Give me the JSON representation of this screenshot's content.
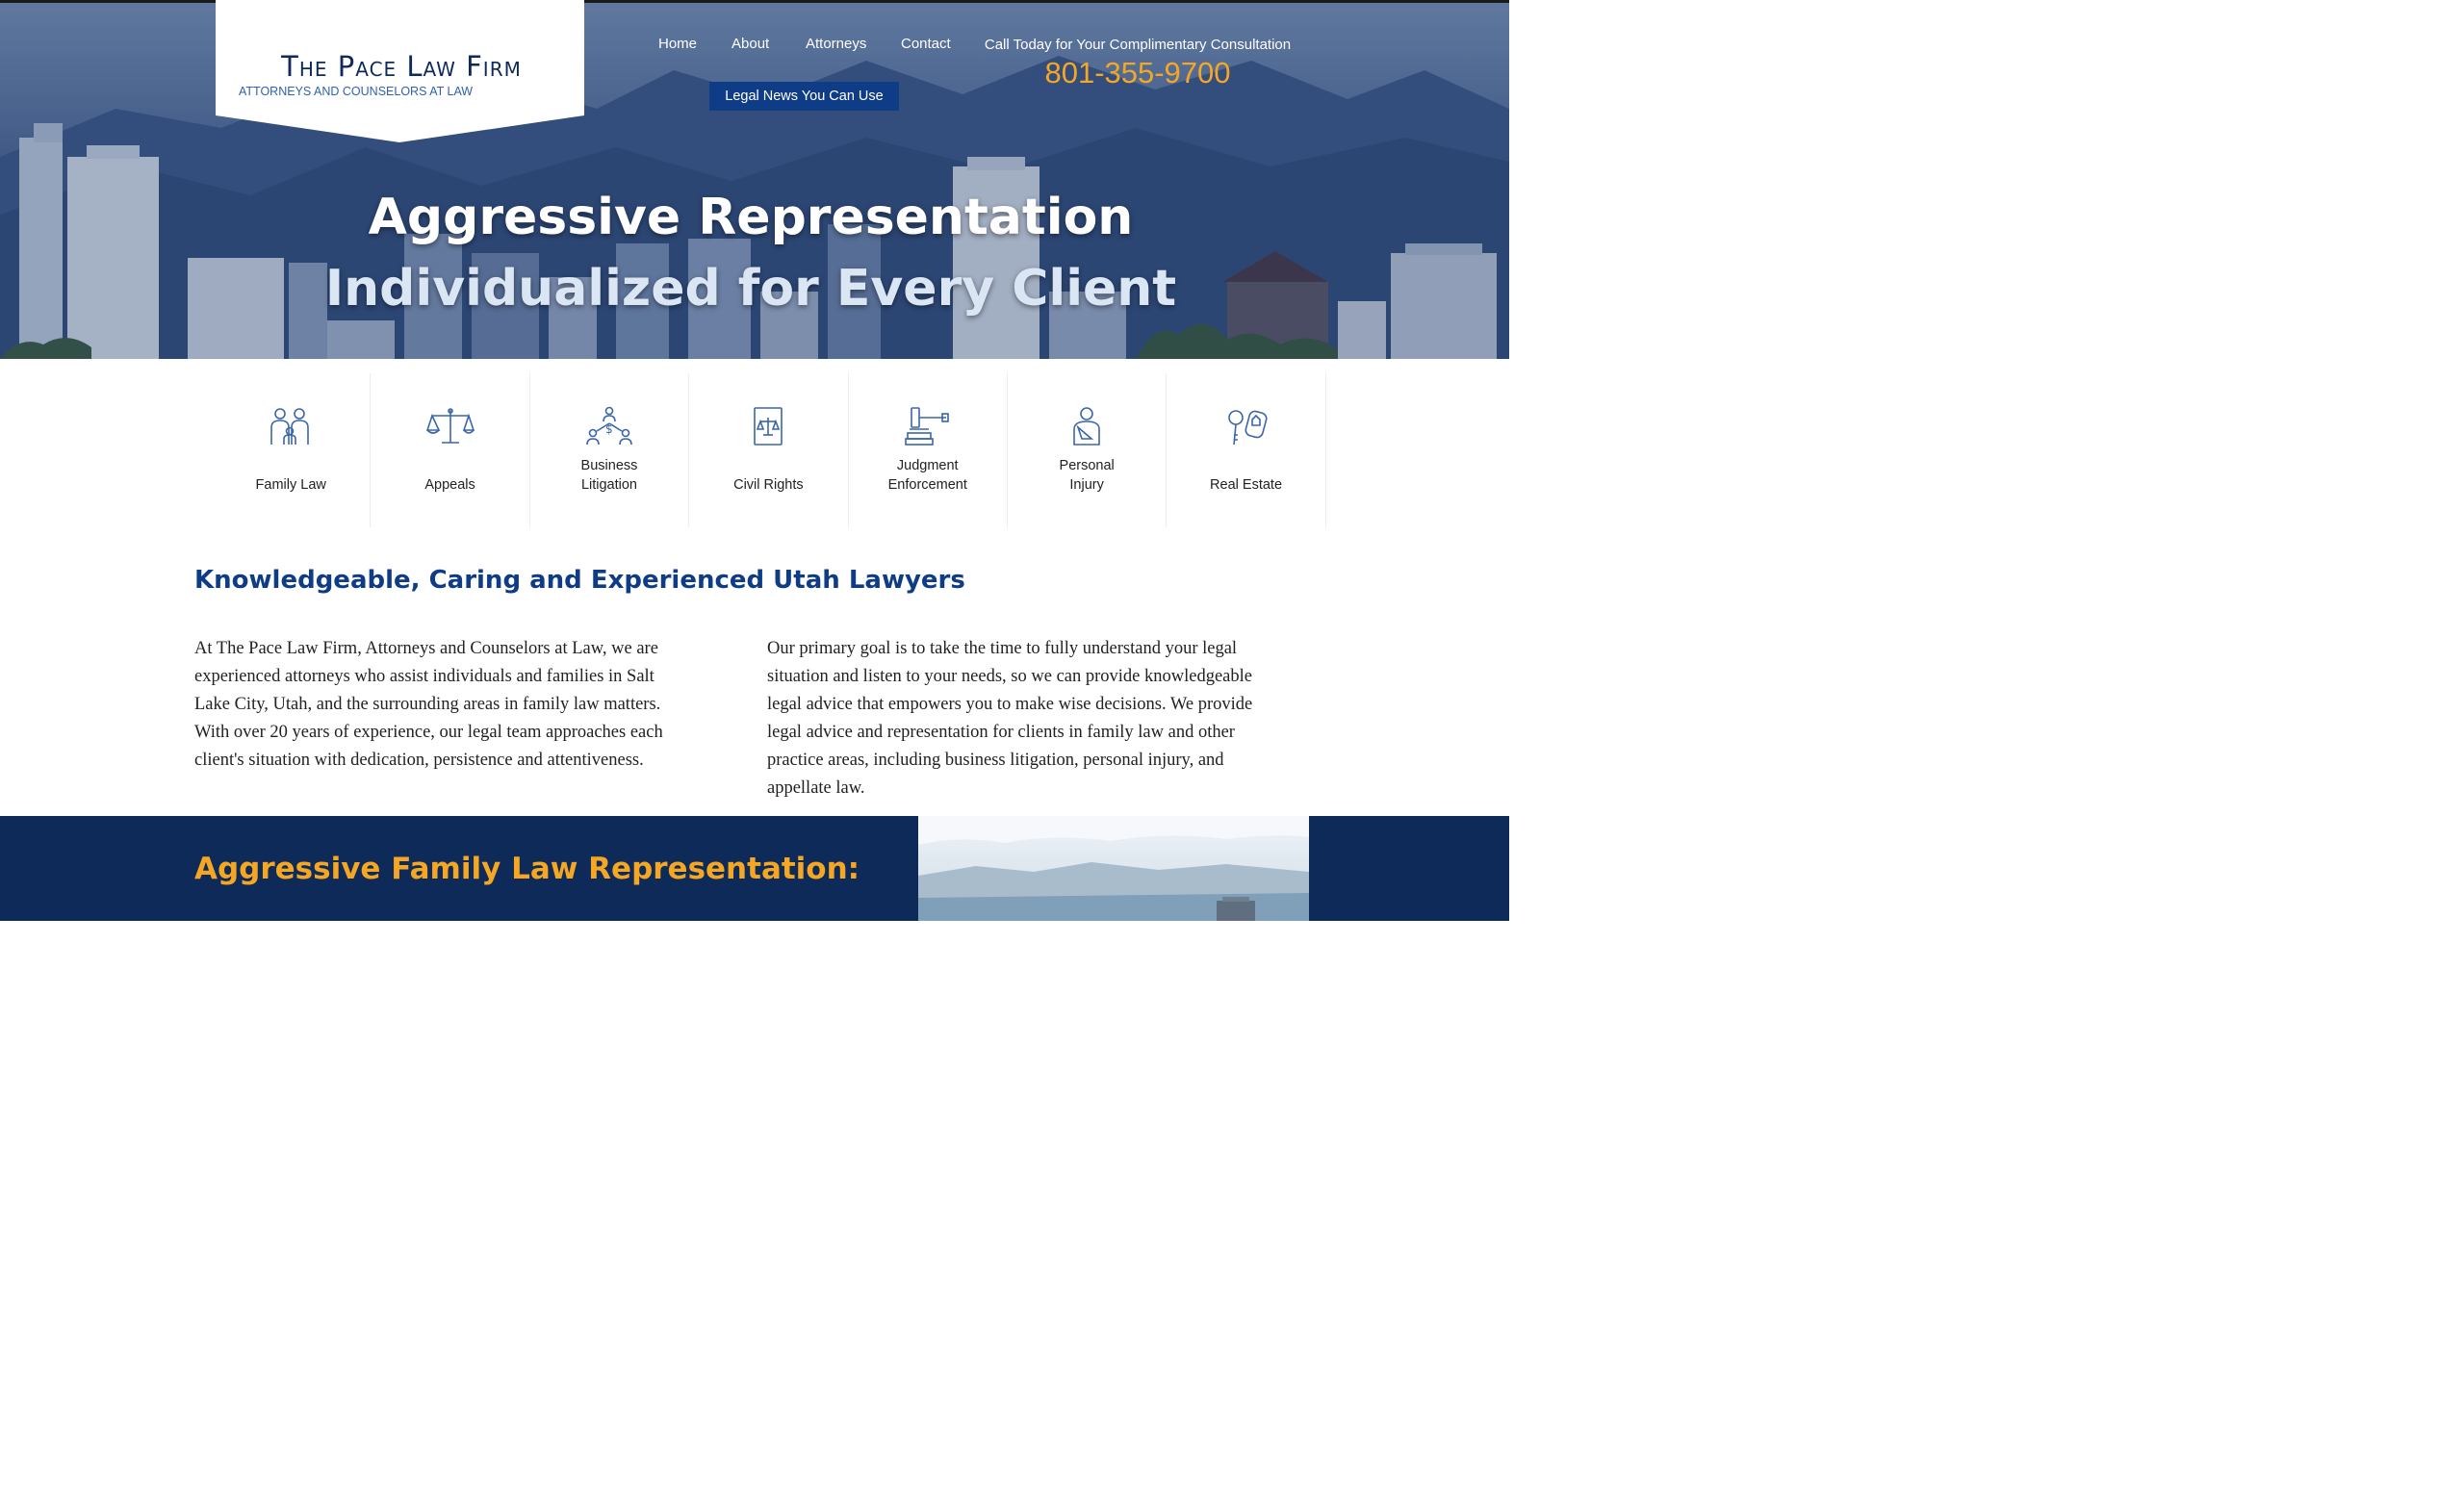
{
  "logo": {
    "title": "The Pace Law Firm",
    "subtitle": "ATTORNEYS AND COUNSELORS AT LAW"
  },
  "nav": {
    "items": [
      "Home",
      "About",
      "Attorneys",
      "Contact"
    ],
    "legal_news": "Legal News You Can Use"
  },
  "cta": {
    "text": "Call Today for Your Complimentary Consultation",
    "phone": "801-355-9700"
  },
  "hero": {
    "line1": "Aggressive Representation",
    "line2": "Individualized for Every Client"
  },
  "practice_areas": [
    {
      "icon": "family-icon",
      "label": "Family Law"
    },
    {
      "icon": "scales-icon",
      "label": "Appeals"
    },
    {
      "icon": "business-icon",
      "label": "Business Litigation"
    },
    {
      "icon": "civil-rights-book-icon",
      "label": "Civil Rights"
    },
    {
      "icon": "gavel-icon",
      "label": "Judgment Enforcement"
    },
    {
      "icon": "injured-person-icon",
      "label": "Personal Injury"
    },
    {
      "icon": "house-keys-icon",
      "label": "Real Estate"
    }
  ],
  "intro": {
    "heading": "Knowledgeable, Caring and Experienced Utah Lawyers",
    "left": "At The Pace Law Firm, Attorneys and Counselors at Law, we are experienced attorneys who assist individuals and families in Salt Lake City, Utah, and the surrounding areas in family law matters. With over 20 years of experience, our legal team approaches each client's situation with dedication, persistence and attentiveness.",
    "right": "Our primary goal is to take the time to fully understand your legal situation and listen to your needs, so we can provide knowledgeable legal advice that empowers you to make wise decisions. We provide legal advice and representation for clients in family law and other practice areas, including business litigation, personal injury, and appellate law."
  },
  "band": {
    "heading": "Aggressive Family Law Representation:"
  },
  "colors": {
    "navy": "#0e2a58",
    "brand_blue": "#0e3c86",
    "accent_orange": "#f5a623",
    "icon_blue": "#3a66a8"
  }
}
